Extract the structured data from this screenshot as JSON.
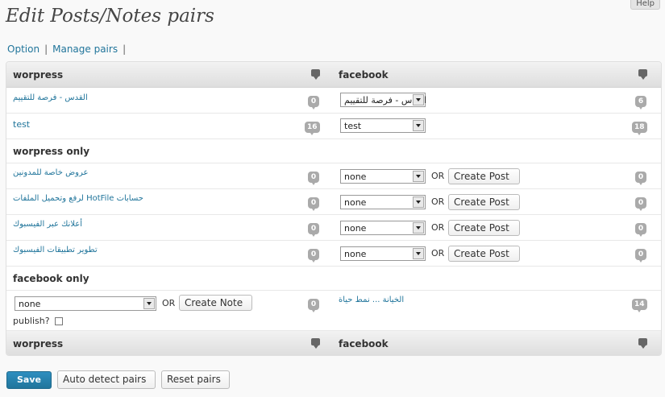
{
  "help_tab": "Help",
  "page_title": "Edit Posts/Notes pairs",
  "subnav": {
    "option": "Option",
    "manage_pairs": "Manage pairs",
    "sep": "|"
  },
  "table": {
    "header": {
      "left": "worpress",
      "right": "facebook"
    },
    "pairs": [
      {
        "wp_title": "القدس - فرصة للتقييم",
        "wp_count": "0",
        "fb_selected": "القدس - فرصة للتقييم",
        "fb_count": "6"
      },
      {
        "wp_title": "test",
        "wp_count": "16",
        "fb_selected": "test",
        "fb_count": "18"
      }
    ],
    "wp_only_label": "worpress only",
    "wp_only": [
      {
        "title": "عروض خاصة للمدونين",
        "count": "0",
        "selected": "none",
        "or": "OR",
        "button": "Create Post",
        "fb_count": "0"
      },
      {
        "title": "لرفع وتحميل الملفات HotFile حسابات",
        "count": "0",
        "selected": "none",
        "or": "OR",
        "button": "Create Post",
        "fb_count": "0"
      },
      {
        "title": "أعلانك عبر الفيسبوك",
        "count": "0",
        "selected": "none",
        "or": "OR",
        "button": "Create Post",
        "fb_count": "0"
      },
      {
        "title": "تطوير تطبيقات الفيسبوك",
        "count": "0",
        "selected": "none",
        "or": "OR",
        "button": "Create Post",
        "fb_count": "0"
      }
    ],
    "fb_only_label": "facebook only",
    "fb_only": [
      {
        "selected": "none",
        "or": "OR",
        "button": "Create Note",
        "publish_label": "publish?",
        "wp_count": "0",
        "fb_title": "الخيانة ... نمط حياة",
        "fb_count": "14"
      }
    ],
    "footer": {
      "left": "worpress",
      "right": "facebook"
    }
  },
  "actions": {
    "save": "Save",
    "auto_detect": "Auto detect pairs",
    "reset": "Reset pairs"
  },
  "colors": {
    "link": "#21759b",
    "primary": "#21759b",
    "count_bubble": "#aaaaaa"
  }
}
